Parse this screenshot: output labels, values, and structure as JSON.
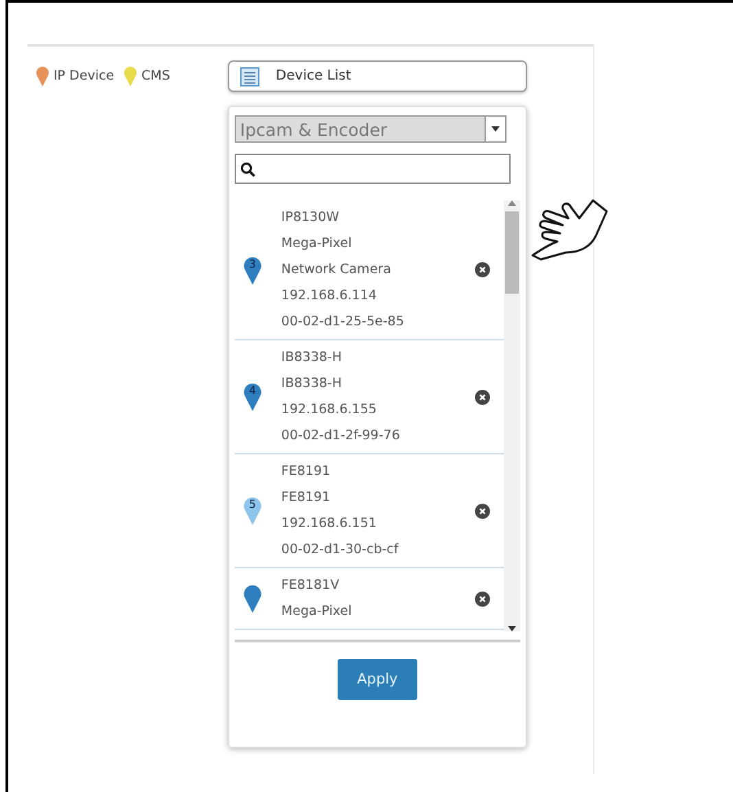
{
  "legend": [
    {
      "label": "IP Device",
      "color": "#e8925a"
    },
    {
      "label": "CMS",
      "color": "#e8dc4a"
    }
  ],
  "device_list_button": {
    "label": "Device List"
  },
  "filter": {
    "value": "Ipcam & Encoder"
  },
  "devices": [
    {
      "number": "3",
      "color": "#2f7fc0",
      "lines": [
        "IP8130W",
        "Mega-Pixel",
        "Network Camera",
        "192.168.6.114",
        "00-02-d1-25-5e-85"
      ]
    },
    {
      "number": "4",
      "color": "#2f7fc0",
      "lines": [
        "IB8338-H",
        "IB8338-H",
        "192.168.6.155",
        "00-02-d1-2f-99-76"
      ]
    },
    {
      "number": "5",
      "color": "#8cc4ea",
      "lines": [
        "FE8191",
        "FE8191",
        "192.168.6.151",
        "00-02-d1-30-cb-cf"
      ]
    },
    {
      "color": "#2f7fc0",
      "lines": [
        "FE8181V",
        "Mega-Pixel"
      ]
    }
  ],
  "apply_button": {
    "label": "Apply"
  }
}
